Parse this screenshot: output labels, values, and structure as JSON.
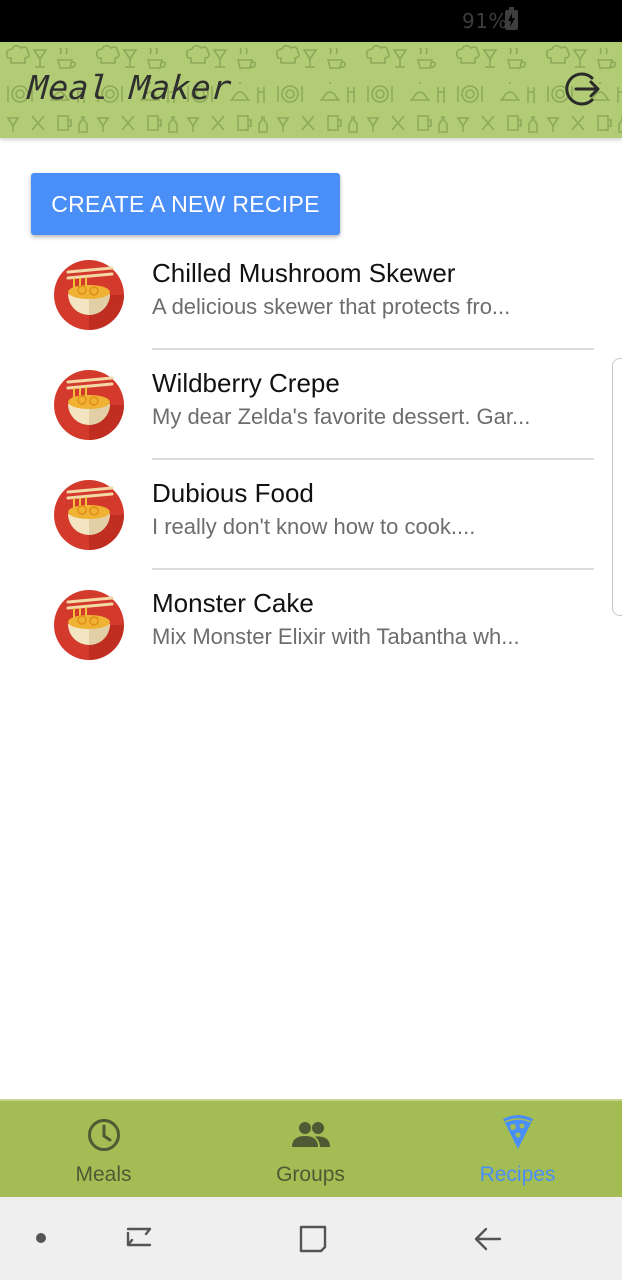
{
  "status_bar": {
    "battery_percent": "91%",
    "battery_icon": "battery-charging-icon"
  },
  "app_bar": {
    "title": "Meal Maker",
    "logout_icon": "logout-icon",
    "background_color": "#b2cc75"
  },
  "actions": {
    "create_recipe_label": "CREATE A NEW RECIPE",
    "button_color": "#4a8ef7"
  },
  "recipes": [
    {
      "title": "Chilled Mushroom Skewer",
      "description": "A delicious skewer that protects fro...",
      "icon": "noodle-bowl-icon"
    },
    {
      "title": "Wildberry Crepe",
      "description": "My dear Zelda's favorite dessert. Gar...",
      "icon": "noodle-bowl-icon"
    },
    {
      "title": "Dubious Food",
      "description": "I really don't know how to cook....",
      "icon": "noodle-bowl-icon"
    },
    {
      "title": "Monster Cake",
      "description": "Mix Monster Elixir with Tabantha wh...",
      "icon": "noodle-bowl-icon"
    }
  ],
  "bottom_nav": {
    "background_color": "#a3bd54",
    "active_color": "#4a8ef7",
    "items": [
      {
        "label": "Meals",
        "icon": "clock-icon",
        "active": false
      },
      {
        "label": "Groups",
        "icon": "people-icon",
        "active": false
      },
      {
        "label": "Recipes",
        "icon": "pizza-slice-icon",
        "active": true
      }
    ]
  },
  "system_nav": {
    "buttons": [
      "dot-icon",
      "recents-icon",
      "home-icon",
      "back-icon"
    ]
  }
}
